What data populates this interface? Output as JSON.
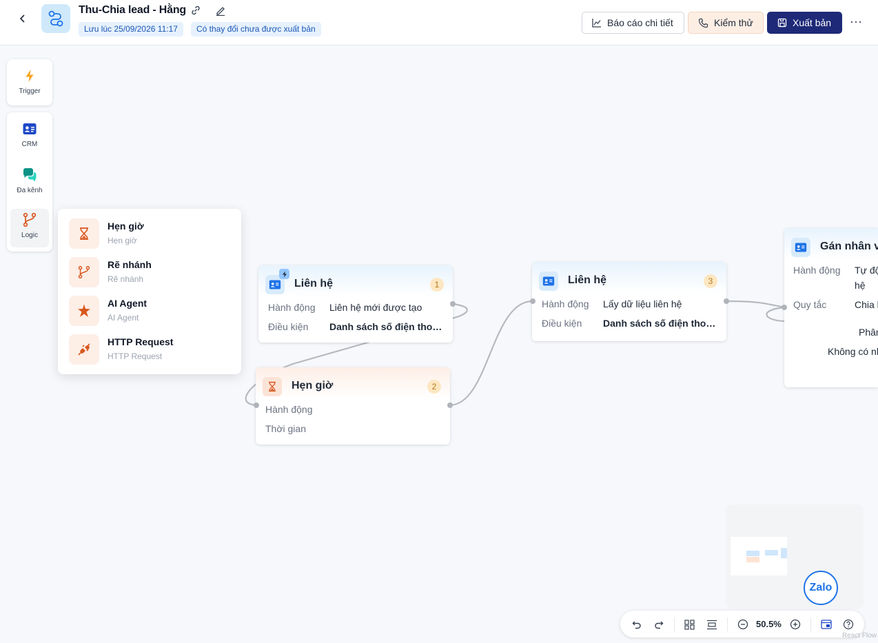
{
  "header": {
    "title": "Thu-Chia lead - Hằng",
    "saved_at": "Lưu lúc 25/09/2026 11:17",
    "unpublished_note": "Có thay đổi chưa được xuất bản",
    "report_label": "Báo cáo chi tiết",
    "test_label": "Kiểm thử",
    "publish_label": "Xuất bản",
    "more_label": "···"
  },
  "palette": {
    "trigger": "Trigger",
    "crm": "CRM",
    "omni": "Đa kênh",
    "logic": "Logic"
  },
  "logic_popup": {
    "items": [
      {
        "name": "Hẹn giờ",
        "sub": "Hẹn giờ",
        "icon": "hourglass-icon"
      },
      {
        "name": "Rẽ nhánh",
        "sub": "Rẽ nhánh",
        "icon": "branch-icon"
      },
      {
        "name": "AI Agent",
        "sub": "AI Agent",
        "icon": "sparkle-icon"
      },
      {
        "name": "HTTP Request",
        "sub": "HTTP Request",
        "icon": "plug-icon"
      }
    ]
  },
  "nodes": {
    "n1": {
      "title": "Liên hệ",
      "num": "1",
      "action_label": "Hành động",
      "action_value": "Liên hệ mới được tạo",
      "cond_label": "Điều kiện",
      "cond_value": "Danh sách số điện thoại chứa"
    },
    "n2": {
      "title": "Hẹn giờ",
      "num": "2",
      "action_label": "Hành động",
      "time_label": "Thời gian"
    },
    "n3": {
      "title": "Liên hệ",
      "num": "3",
      "action_label": "Hành động",
      "action_value": "Lấy dữ liệu liên hệ",
      "cond_label": "Điều kiện",
      "cond_value": "Danh sách số điện thoại chứa"
    },
    "n4": {
      "title": "Gán nhân vi",
      "action_label": "Hành động",
      "action_value": "Tự độ",
      "action_value2": "hệ",
      "rule_label": "Quy tắc",
      "rule_value": "Chia l",
      "extra1": "Phân",
      "extra2": "Không có nh"
    }
  },
  "minimap": {
    "zalo_label": "Zalo"
  },
  "toolbar": {
    "zoom": "50.5%"
  },
  "brand": "React Flow",
  "colors": {
    "primary": "#1e2a78",
    "accent_blue": "#1e73e8",
    "logic_orange": "#d9561d",
    "trigger_yellow": "#f5a623"
  }
}
